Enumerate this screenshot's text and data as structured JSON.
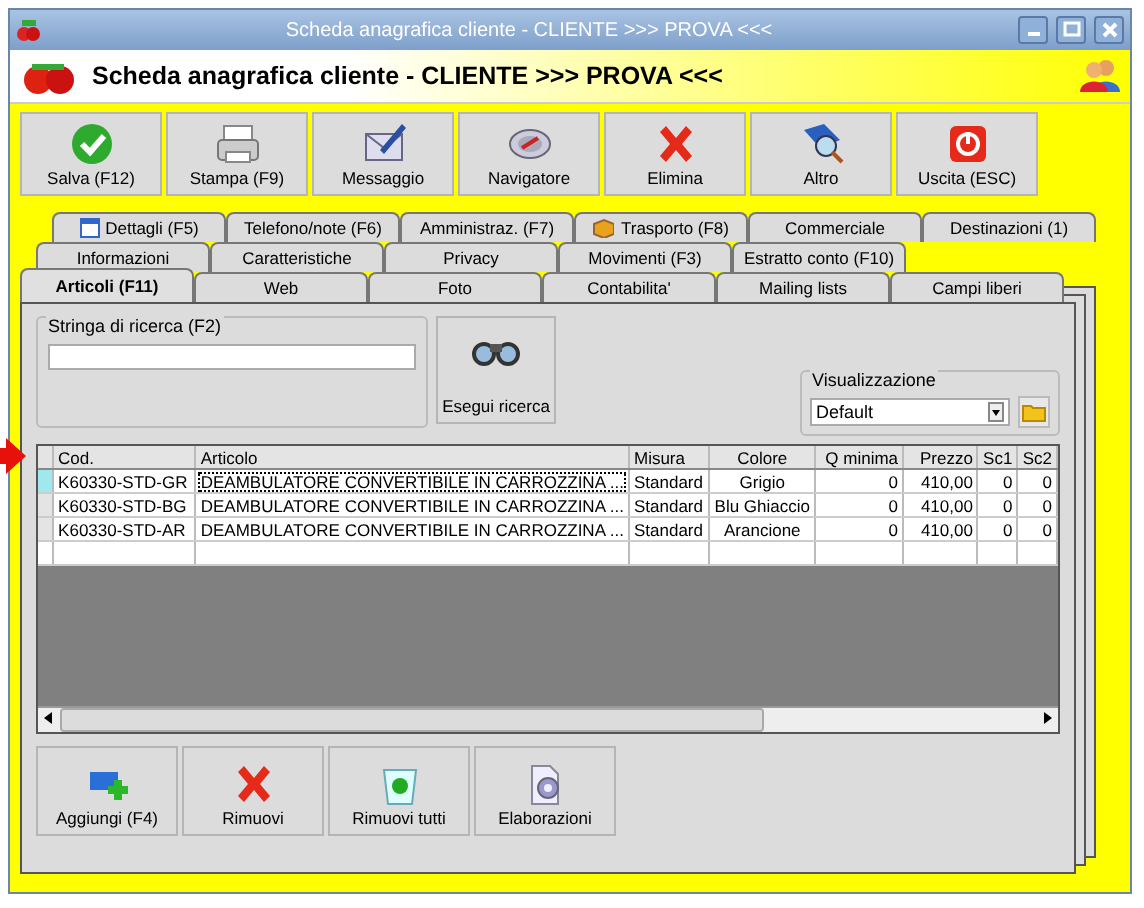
{
  "window": {
    "title": "Scheda anagrafica cliente - CLIENTE >>> PROVA <<<"
  },
  "header": {
    "title": "Scheda anagrafica cliente - CLIENTE >>> PROVA <<<"
  },
  "toolbar": [
    "Salva (F12)",
    "Stampa (F9)",
    "Messaggio",
    "Navigatore",
    "Elimina",
    "Altro",
    "Uscita (ESC)"
  ],
  "tab_rows": [
    [
      {
        "label": "Dettagli (F5)",
        "selected": false
      },
      {
        "label": "Telefono/note (F6)",
        "selected": false
      },
      {
        "label": "Amministraz. (F7)",
        "selected": false
      },
      {
        "label": "Trasporto (F8)",
        "selected": false
      },
      {
        "label": "Commerciale",
        "selected": false
      },
      {
        "label": "Destinazioni (1)",
        "selected": false
      }
    ],
    [
      {
        "label": "Informazioni",
        "selected": false
      },
      {
        "label": "Caratteristiche",
        "selected": false
      },
      {
        "label": "Privacy",
        "selected": false
      },
      {
        "label": "Movimenti (F3)",
        "selected": false
      },
      {
        "label": "Estratto conto (F10)",
        "selected": false
      }
    ],
    [
      {
        "label": "Articoli (F11)",
        "selected": true
      },
      {
        "label": "Web",
        "selected": false
      },
      {
        "label": "Foto",
        "selected": false
      },
      {
        "label": "Contabilita'",
        "selected": false
      },
      {
        "label": "Mailing lists",
        "selected": false
      },
      {
        "label": "Campi liberi",
        "selected": false
      }
    ]
  ],
  "search": {
    "label": "Stringa di ricerca (F2)",
    "button": "Esegui ricerca"
  },
  "view": {
    "label": "Visualizzazione",
    "value": "Default"
  },
  "table": {
    "columns": [
      "Cod.",
      "Articolo",
      "Misura",
      "Colore",
      "Q minima",
      "Prezzo",
      "Sc1",
      "Sc2"
    ],
    "rows": [
      {
        "selected": true,
        "cells": [
          "K60330-STD-GR",
          "DEAMBULATORE CONVERTIBILE IN CARROZZINA ...",
          "Standard",
          "Grigio",
          "0",
          "410,00",
          "0",
          "0"
        ]
      },
      {
        "selected": false,
        "cells": [
          "K60330-STD-BG",
          "DEAMBULATORE CONVERTIBILE IN CARROZZINA ...",
          "Standard",
          "Blu Ghiaccio",
          "0",
          "410,00",
          "0",
          "0"
        ]
      },
      {
        "selected": false,
        "cells": [
          "K60330-STD-AR",
          "DEAMBULATORE CONVERTIBILE IN CARROZZINA ...",
          "Standard",
          "Arancione",
          "0",
          "410,00",
          "0",
          "0"
        ]
      }
    ]
  },
  "actions": [
    "Aggiungi (F4)",
    "Rimuovi",
    "Rimuovi tutti",
    "Elaborazioni"
  ]
}
